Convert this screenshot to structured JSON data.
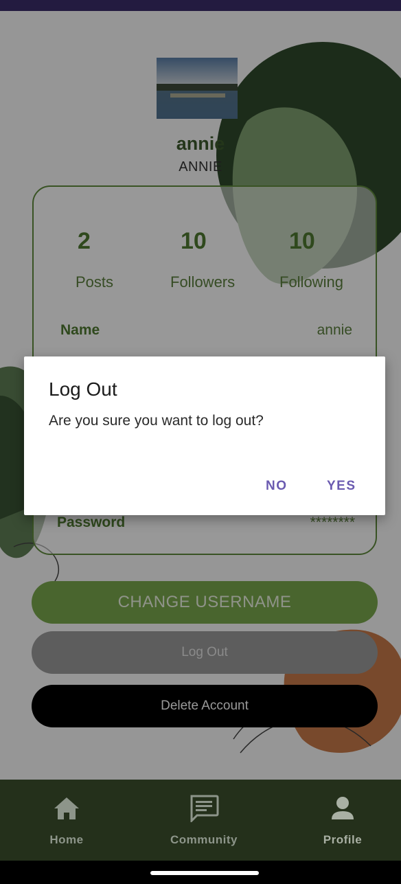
{
  "profile": {
    "username": "annie",
    "display_name": "ANNIE",
    "stats": [
      {
        "value": "2",
        "label": "Posts"
      },
      {
        "value": "10",
        "label": "Followers"
      },
      {
        "value": "10",
        "label": "Following"
      }
    ],
    "fields": [
      {
        "label": "Name",
        "value": "annie"
      },
      {
        "label": "Password",
        "value": "********"
      }
    ]
  },
  "actions": {
    "change_username": "CHANGE USERNAME",
    "log_out": "Log Out",
    "delete_account": "Delete Account"
  },
  "dialog": {
    "title": "Log Out",
    "message": "Are you sure you want to log out?",
    "no_label": "NO",
    "yes_label": "YES"
  },
  "bottom_nav": {
    "items": [
      {
        "label": "Home",
        "icon": "home-icon"
      },
      {
        "label": "Community",
        "icon": "chat-icon"
      },
      {
        "label": "Profile",
        "icon": "person-icon",
        "active": true
      }
    ]
  },
  "colors": {
    "status_bar": "#3b2d6b",
    "accent_green": "#4f7a31",
    "nav_background": "#24301b",
    "dialog_button": "#6a5ab0"
  }
}
